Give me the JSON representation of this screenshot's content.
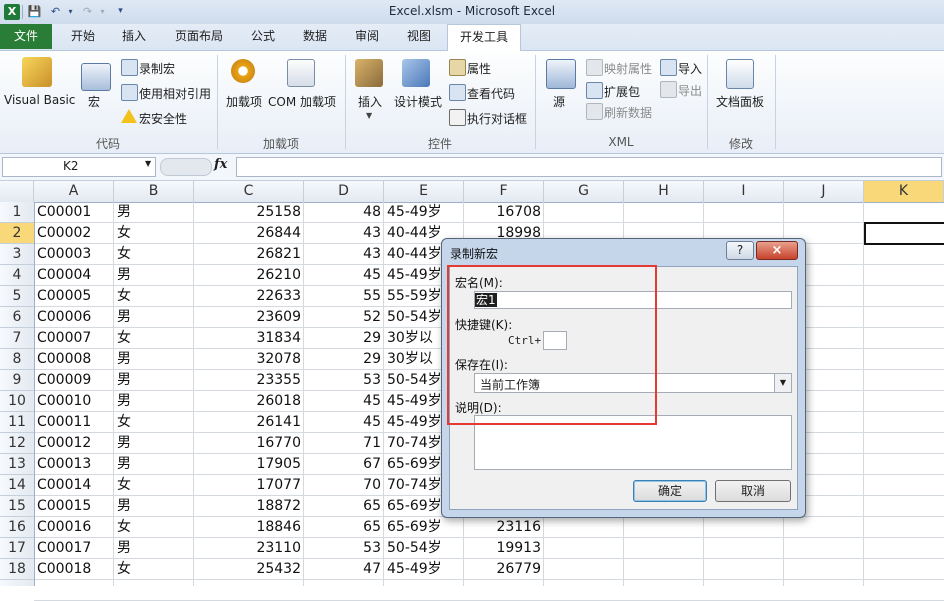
{
  "window": {
    "title": "Excel.xlsm  -  Microsoft Excel"
  },
  "tabs": [
    "文件",
    "开始",
    "插入",
    "页面布局",
    "公式",
    "数据",
    "审阅",
    "视图",
    "开发工具"
  ],
  "ribbon": {
    "code": {
      "label": "代码",
      "visual_basic": "Visual Basic",
      "macros": "宏",
      "record_macro": "录制宏",
      "relative_ref": "使用相对引用",
      "macro_security": "宏安全性"
    },
    "addins": {
      "label": "加载项",
      "addins": "加载项",
      "com_addins": "COM 加载项"
    },
    "controls": {
      "label": "控件",
      "insert": "插入",
      "design_mode": "设计模式",
      "properties": "属性",
      "view_code": "查看代码",
      "run_dialog": "执行对话框"
    },
    "xml": {
      "label": "XML",
      "source": "源",
      "map_props": "映射属性",
      "expansion_packs": "扩展包",
      "refresh_data": "刷新数据",
      "import": "导入",
      "export": "导出"
    },
    "modify": {
      "label": "修改",
      "doc_panel": "文档面板"
    }
  },
  "formula_bar": {
    "name_box": "K2",
    "fx": "fx",
    "formula": ""
  },
  "columns": [
    "A",
    "B",
    "C",
    "D",
    "E",
    "F",
    "G",
    "H",
    "I",
    "J",
    "K"
  ],
  "rows": [
    [
      "1",
      "C00001",
      "男",
      "25158",
      "48",
      "45-49岁",
      "16708"
    ],
    [
      "2",
      "C00002",
      "女",
      "26844",
      "43",
      "40-44岁",
      "18998"
    ],
    [
      "3",
      "C00003",
      "女",
      "26821",
      "43",
      "40-44岁",
      ""
    ],
    [
      "4",
      "C00004",
      "男",
      "26210",
      "45",
      "45-49岁",
      ""
    ],
    [
      "5",
      "C00005",
      "女",
      "22633",
      "55",
      "55-59岁",
      ""
    ],
    [
      "6",
      "C00006",
      "男",
      "23609",
      "52",
      "50-54岁",
      ""
    ],
    [
      "7",
      "C00007",
      "女",
      "31834",
      "29",
      "30岁以",
      ""
    ],
    [
      "8",
      "C00008",
      "男",
      "32078",
      "29",
      "30岁以",
      ""
    ],
    [
      "9",
      "C00009",
      "男",
      "23355",
      "53",
      "50-54岁",
      ""
    ],
    [
      "10",
      "C00010",
      "男",
      "26018",
      "45",
      "45-49岁",
      ""
    ],
    [
      "11",
      "C00011",
      "女",
      "26141",
      "45",
      "45-49岁",
      ""
    ],
    [
      "12",
      "C00012",
      "男",
      "16770",
      "71",
      "70-74岁",
      ""
    ],
    [
      "13",
      "C00013",
      "男",
      "17905",
      "67",
      "65-69岁",
      ""
    ],
    [
      "14",
      "C00014",
      "女",
      "17077",
      "70",
      "70-74岁",
      ""
    ],
    [
      "15",
      "C00015",
      "男",
      "18872",
      "65",
      "65-69岁",
      ""
    ],
    [
      "16",
      "C00016",
      "女",
      "18846",
      "65",
      "65-69岁",
      "23116"
    ],
    [
      "17",
      "C00017",
      "男",
      "23110",
      "53",
      "50-54岁",
      "19913"
    ],
    [
      "18",
      "C00018",
      "女",
      "25432",
      "47",
      "45-49岁",
      "26779"
    ]
  ],
  "dialog": {
    "title": "录制新宏",
    "help": "?",
    "close": "×",
    "macro_name_label": "宏名(M):",
    "macro_name_value": "宏1",
    "shortcut_label": "快捷键(K):",
    "ctrl_label": "Ctrl+",
    "shortcut_value": "",
    "store_in_label": "保存在(I):",
    "store_in_value": "当前工作簿",
    "description_label": "说明(D):",
    "description_value": "",
    "ok": "确定",
    "cancel": "取消"
  },
  "colors": {
    "file_tab": "#2a7d36",
    "highlight_box": "#e53935",
    "selected_header": "#f9d87a"
  }
}
